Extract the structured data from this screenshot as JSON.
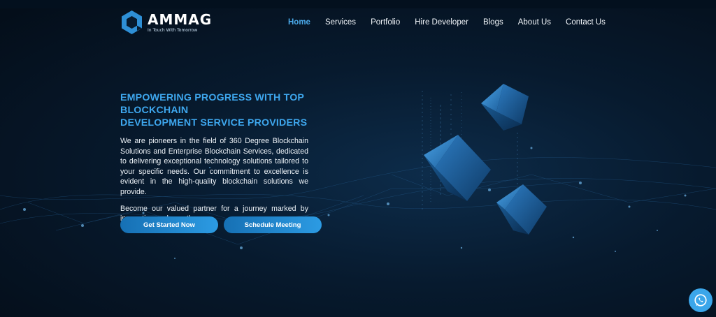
{
  "brand": {
    "name": "AMMAG",
    "tagline": "In Touch With Tomorrow"
  },
  "nav": {
    "items": [
      {
        "label": "Home",
        "active": true
      },
      {
        "label": "Services",
        "active": false
      },
      {
        "label": "Portfolio",
        "active": false
      },
      {
        "label": "Hire Developer",
        "active": false
      },
      {
        "label": "Blogs",
        "active": false
      },
      {
        "label": "About Us",
        "active": false
      },
      {
        "label": "Contact Us",
        "active": false
      }
    ]
  },
  "hero": {
    "headline_line1": "EMPOWERING PROGRESS WITH TOP BLOCKCHAIN",
    "headline_line2": "DEVELOPMENT SERVICE PROVIDERS",
    "paragraph1": "We are pioneers in the field of 360 Degree Blockchain Solutions and Enterprise Blockchain Services, dedicated to delivering exceptional technology solutions tailored to your specific needs. Our commitment to excellence is evident in the high-quality blockchain solutions we provide.",
    "paragraph2": "Become our valued partner for a journey marked by innovation and growth.",
    "primary_button": "Get Started Now",
    "secondary_button": "Schedule Meeting"
  },
  "colors": {
    "accent": "#3ea7ee",
    "background": "#071a2e",
    "button": "#1f86cc",
    "whatsapp": "#3ba6ea"
  },
  "icons": {
    "logo": "hexagon-logo-icon",
    "chat": "whatsapp-icon"
  }
}
